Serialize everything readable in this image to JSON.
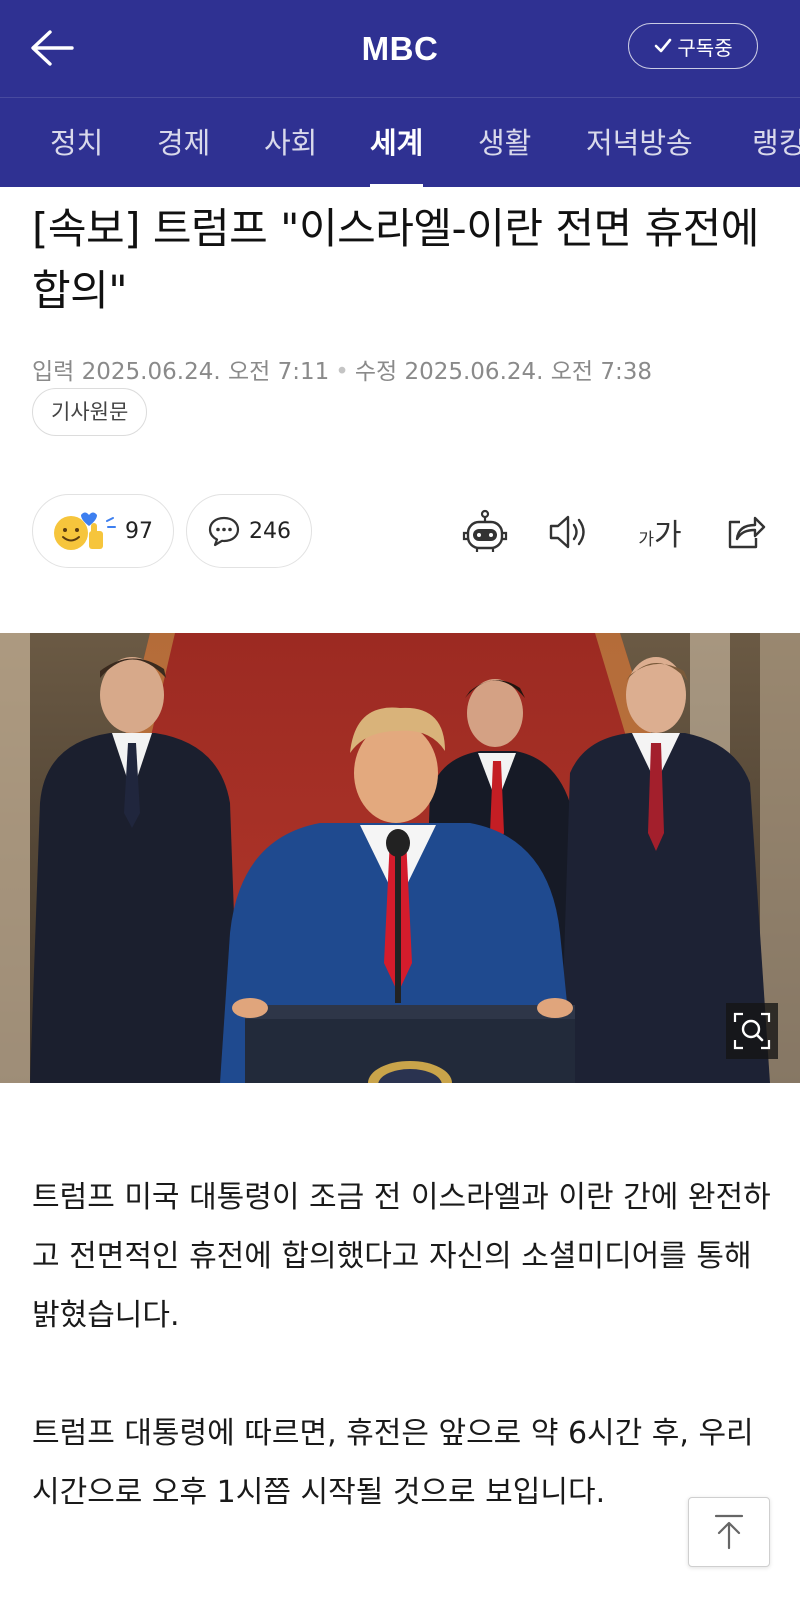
{
  "header": {
    "brand": "MBC",
    "subscribe_label": "구독중"
  },
  "tabs": [
    {
      "label": "정치",
      "active": false
    },
    {
      "label": "경제",
      "active": false
    },
    {
      "label": "사회",
      "active": false
    },
    {
      "label": "세계",
      "active": true
    },
    {
      "label": "생활",
      "active": false
    },
    {
      "label": "저녁방송",
      "active": false
    },
    {
      "label": "랭킹",
      "active": false
    }
  ],
  "article": {
    "title": "[속보] 트럼프 \"이스라엘-이란 전면 휴전에 합의\"",
    "input_label": "입력",
    "input_date": "2025.06.24. 오전 7:11",
    "modified_label": "수정",
    "modified_date": "2025.06.24. 오전 7:38",
    "original_button": "기사원문",
    "paragraphs": [
      "트럼프 미국 대통령이 조금 전 이스라엘과 이란 간에 완전하고 전면적인 휴전에 합의했다고 자신의 소셜미디어를 통해 밝혔습니다.",
      "트럼프 대통령에 따르면, 휴전은 앞으로 약 6시간 후, 우리 시간으로 오후 1시쯤 시작될 것으로 보입니다."
    ]
  },
  "actions": {
    "reaction_count": "97",
    "comment_count": "246",
    "font_size_small": "가",
    "font_size_big": "가"
  },
  "icons": {
    "back": "arrow-left-icon",
    "subscribe_check": "check-icon",
    "reaction": "reaction-emoji-icon",
    "comment": "speech-bubble-icon",
    "summary": "robot-icon",
    "tts": "speaker-icon",
    "font": "font-size-icon",
    "share": "share-icon",
    "zoom": "zoom-icon",
    "top": "arrow-up-icon"
  },
  "colors": {
    "brand_blue": "#2f3192"
  }
}
